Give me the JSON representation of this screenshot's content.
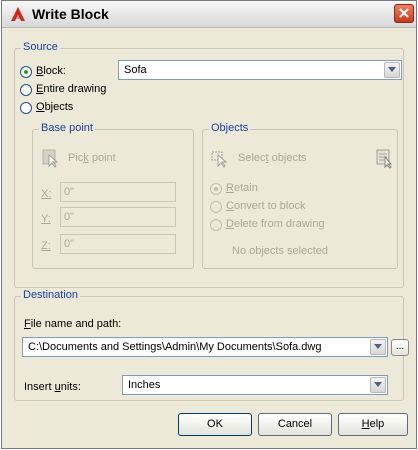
{
  "window": {
    "title": "Write Block",
    "app_icon": "autocad-a-icon",
    "close_icon": "close-x-icon"
  },
  "source": {
    "legend": "Source",
    "block_label_pre": "",
    "block_label_key": "B",
    "block_label_post": "lock:",
    "block_value": "Sofa",
    "entire_pre": "",
    "entire_key": "E",
    "entire_post": "ntire drawing",
    "objects_pre": "",
    "objects_key": "O",
    "objects_post": "bjects",
    "selected": "block"
  },
  "base_point": {
    "legend": "Base point",
    "pick_pre": "Pic",
    "pick_key": "k",
    "pick_post": " point",
    "x_label": "X:",
    "y_label": "Y:",
    "z_label": "Z:",
    "x_value": "0\"",
    "y_value": "0\"",
    "z_value": "0\""
  },
  "objects": {
    "legend": "Objects",
    "select_pre": "Selec",
    "select_key": "t",
    "select_post": " objects",
    "retain_pre": "",
    "retain_key": "R",
    "retain_post": "etain",
    "convert_pre": "",
    "convert_key": "C",
    "convert_post": "onvert to block",
    "delete_pre": "",
    "delete_key": "D",
    "delete_post": "elete from drawing",
    "status": "No objects selected"
  },
  "destination": {
    "legend": "Destination",
    "file_pre": "",
    "file_key": "F",
    "file_post": "ile name and path:",
    "file_value": "C:\\Documents and Settings\\Admin\\My Documents\\Sofa.dwg",
    "browse_label": "...",
    "units_pre": "Insert ",
    "units_key": "u",
    "units_post": "nits:",
    "units_value": "Inches"
  },
  "buttons": {
    "ok": "OK",
    "cancel": "Cancel",
    "help_pre": "",
    "help_key": "H",
    "help_post": "elp"
  },
  "colors": {
    "accent_legend": "#1c3fa6",
    "disabled_text": "#aca899",
    "dialog_bg": "#ece9d8"
  }
}
